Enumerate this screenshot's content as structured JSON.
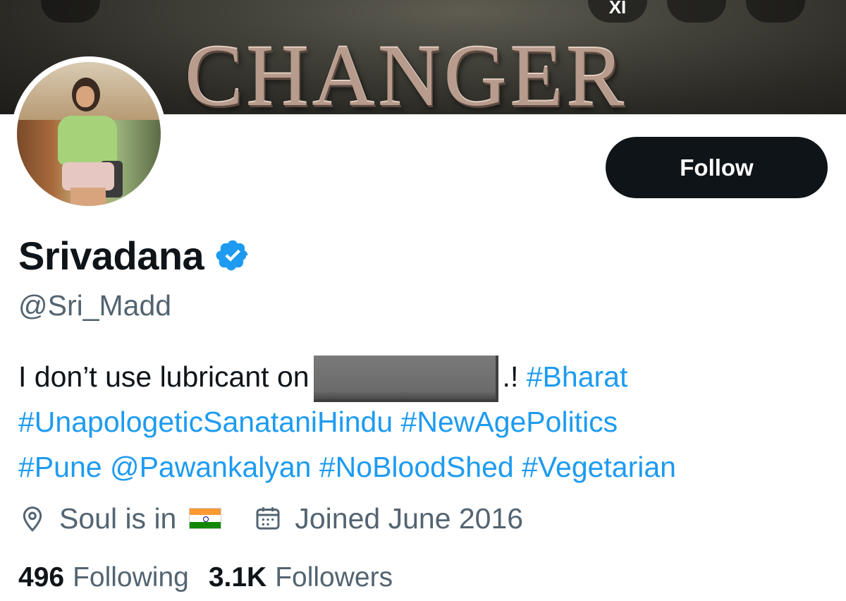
{
  "banner": {
    "title": "CHANGER",
    "buttons": [
      {
        "name": "back-button",
        "icon": "back-arrow-icon",
        "label": ""
      },
      {
        "name": "grok-button",
        "icon": "grok-icon",
        "label": "XI"
      },
      {
        "name": "search-button",
        "icon": "search-icon",
        "label": ""
      },
      {
        "name": "more-button",
        "icon": "more-icon",
        "label": ""
      }
    ]
  },
  "profile": {
    "display_name": "Srivadana",
    "verified": true,
    "handle": "@Sri_Madd",
    "follow_label": "Follow",
    "bio": {
      "line1_text": "I don’t use lubricant on",
      "line1_suffix": ".!",
      "line1_hashtag": "#Bharat",
      "line2_hashtag1": "#UnapologeticSanataniHindu",
      "line2_hashtag2": "#NewAgePolitics",
      "line3_hashtag1": "#Pune",
      "line3_mention": "@Pawankalyan",
      "line3_hashtag2": "#NoBloodShed",
      "line3_hashtag3": "#Vegetarian"
    },
    "location": "Soul is in",
    "location_flag": "india-flag",
    "joined": "Joined June 2016",
    "following_count": "496",
    "following_label": "Following",
    "followers_count": "3.1K",
    "followers_label": "Followers"
  },
  "colors": {
    "accent": "#1d9bf0",
    "text_primary": "#0f1419",
    "text_secondary": "#536471",
    "button_bg": "#0f1419"
  }
}
